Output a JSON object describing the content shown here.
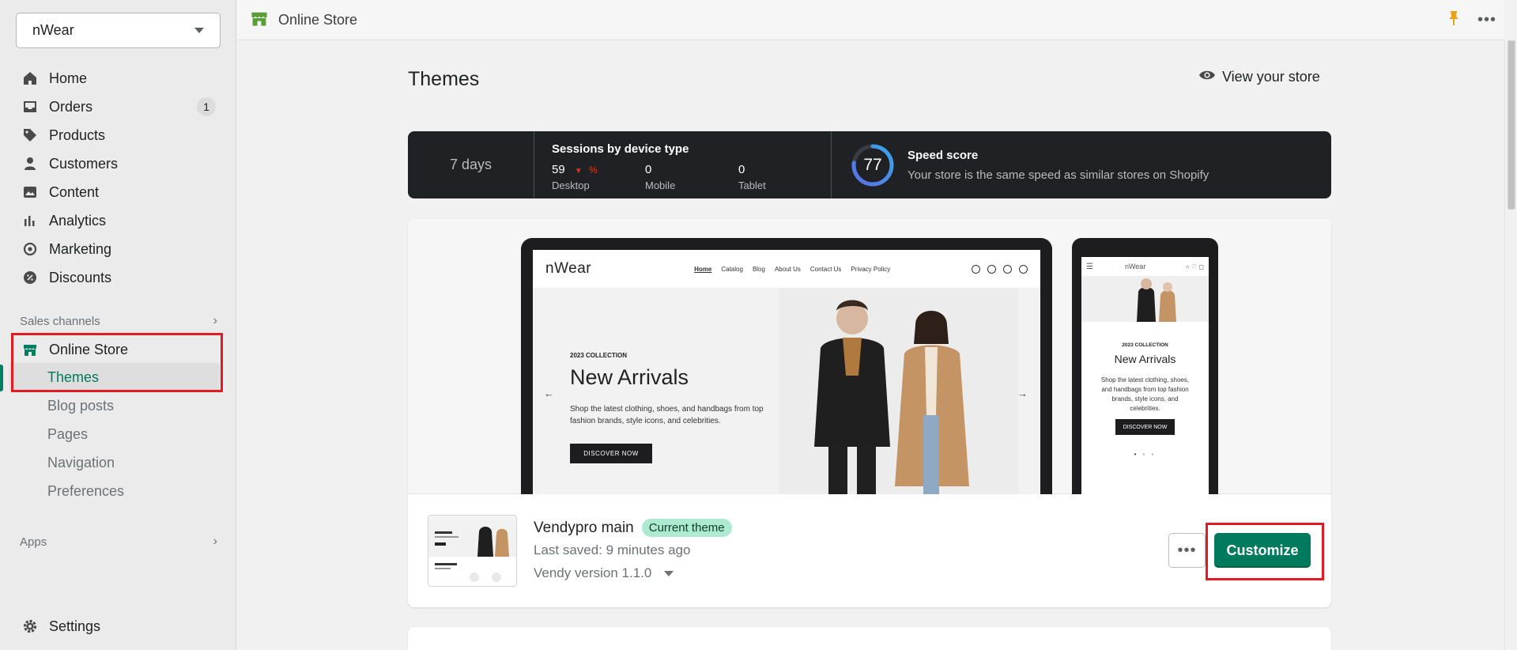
{
  "_comment": "Data for the Shopify Online Store themes page",
  "sidebar": {
    "store_name": "nWear",
    "nav": [
      {
        "label": "Home",
        "icon": "home-icon"
      },
      {
        "label": "Orders",
        "icon": "orders-icon",
        "badge": "1"
      },
      {
        "label": "Products",
        "icon": "tag-icon"
      },
      {
        "label": "Customers",
        "icon": "person-icon"
      },
      {
        "label": "Content",
        "icon": "image-icon"
      },
      {
        "label": "Analytics",
        "icon": "bar-chart-icon"
      },
      {
        "label": "Marketing",
        "icon": "target-icon"
      },
      {
        "label": "Discounts",
        "icon": "discount-icon"
      }
    ],
    "sales_channels_label": "Sales channels",
    "online_store_label": "Online Store",
    "sub_items": [
      "Themes",
      "Blog posts",
      "Pages",
      "Navigation",
      "Preferences"
    ],
    "apps_label": "Apps",
    "settings_label": "Settings"
  },
  "topbar": {
    "title": "Online Store"
  },
  "main": {
    "title": "Themes",
    "view_store_label": "View your store"
  },
  "stats": {
    "period": "7 days",
    "sessions_heading": "Sessions by device type",
    "metrics": [
      {
        "value": "59",
        "change": "%",
        "label": "Desktop"
      },
      {
        "value": "0",
        "label": "Mobile"
      },
      {
        "value": "0",
        "label": "Tablet"
      }
    ],
    "speed_score": "77",
    "speed_score_value": 77,
    "speed_heading": "Speed score",
    "speed_text": "Your store is the same speed as similar stores on Shopify"
  },
  "preview": {
    "logo": "nWear",
    "nav": [
      "Home",
      "Catalog",
      "Blog",
      "About Us",
      "Contact Us",
      "Privacy Policy"
    ],
    "collection": "2023 COLLECTION",
    "headline": "New Arrivals",
    "description": "Shop the latest clothing, shoes, and handbags from top fashion brands, style icons, and celebrities.",
    "cta": "DISCOVER NOW",
    "prev_arrow": "←",
    "next_arrow": "→",
    "mobile_menu": "☰",
    "mobile_dots": "• ◦ ◦"
  },
  "theme": {
    "name": "Vendypro main",
    "badge": "Current theme",
    "last_saved": "Last saved: 9 minutes ago",
    "version": "Vendy version 1.1.0",
    "more_label": "•••",
    "customize_label": "Customize"
  },
  "colors": {
    "accent": "#007a5c",
    "badge_bg": "#aee9d1",
    "stats_bg": "#1f2124",
    "highlight": "#e01b24"
  }
}
